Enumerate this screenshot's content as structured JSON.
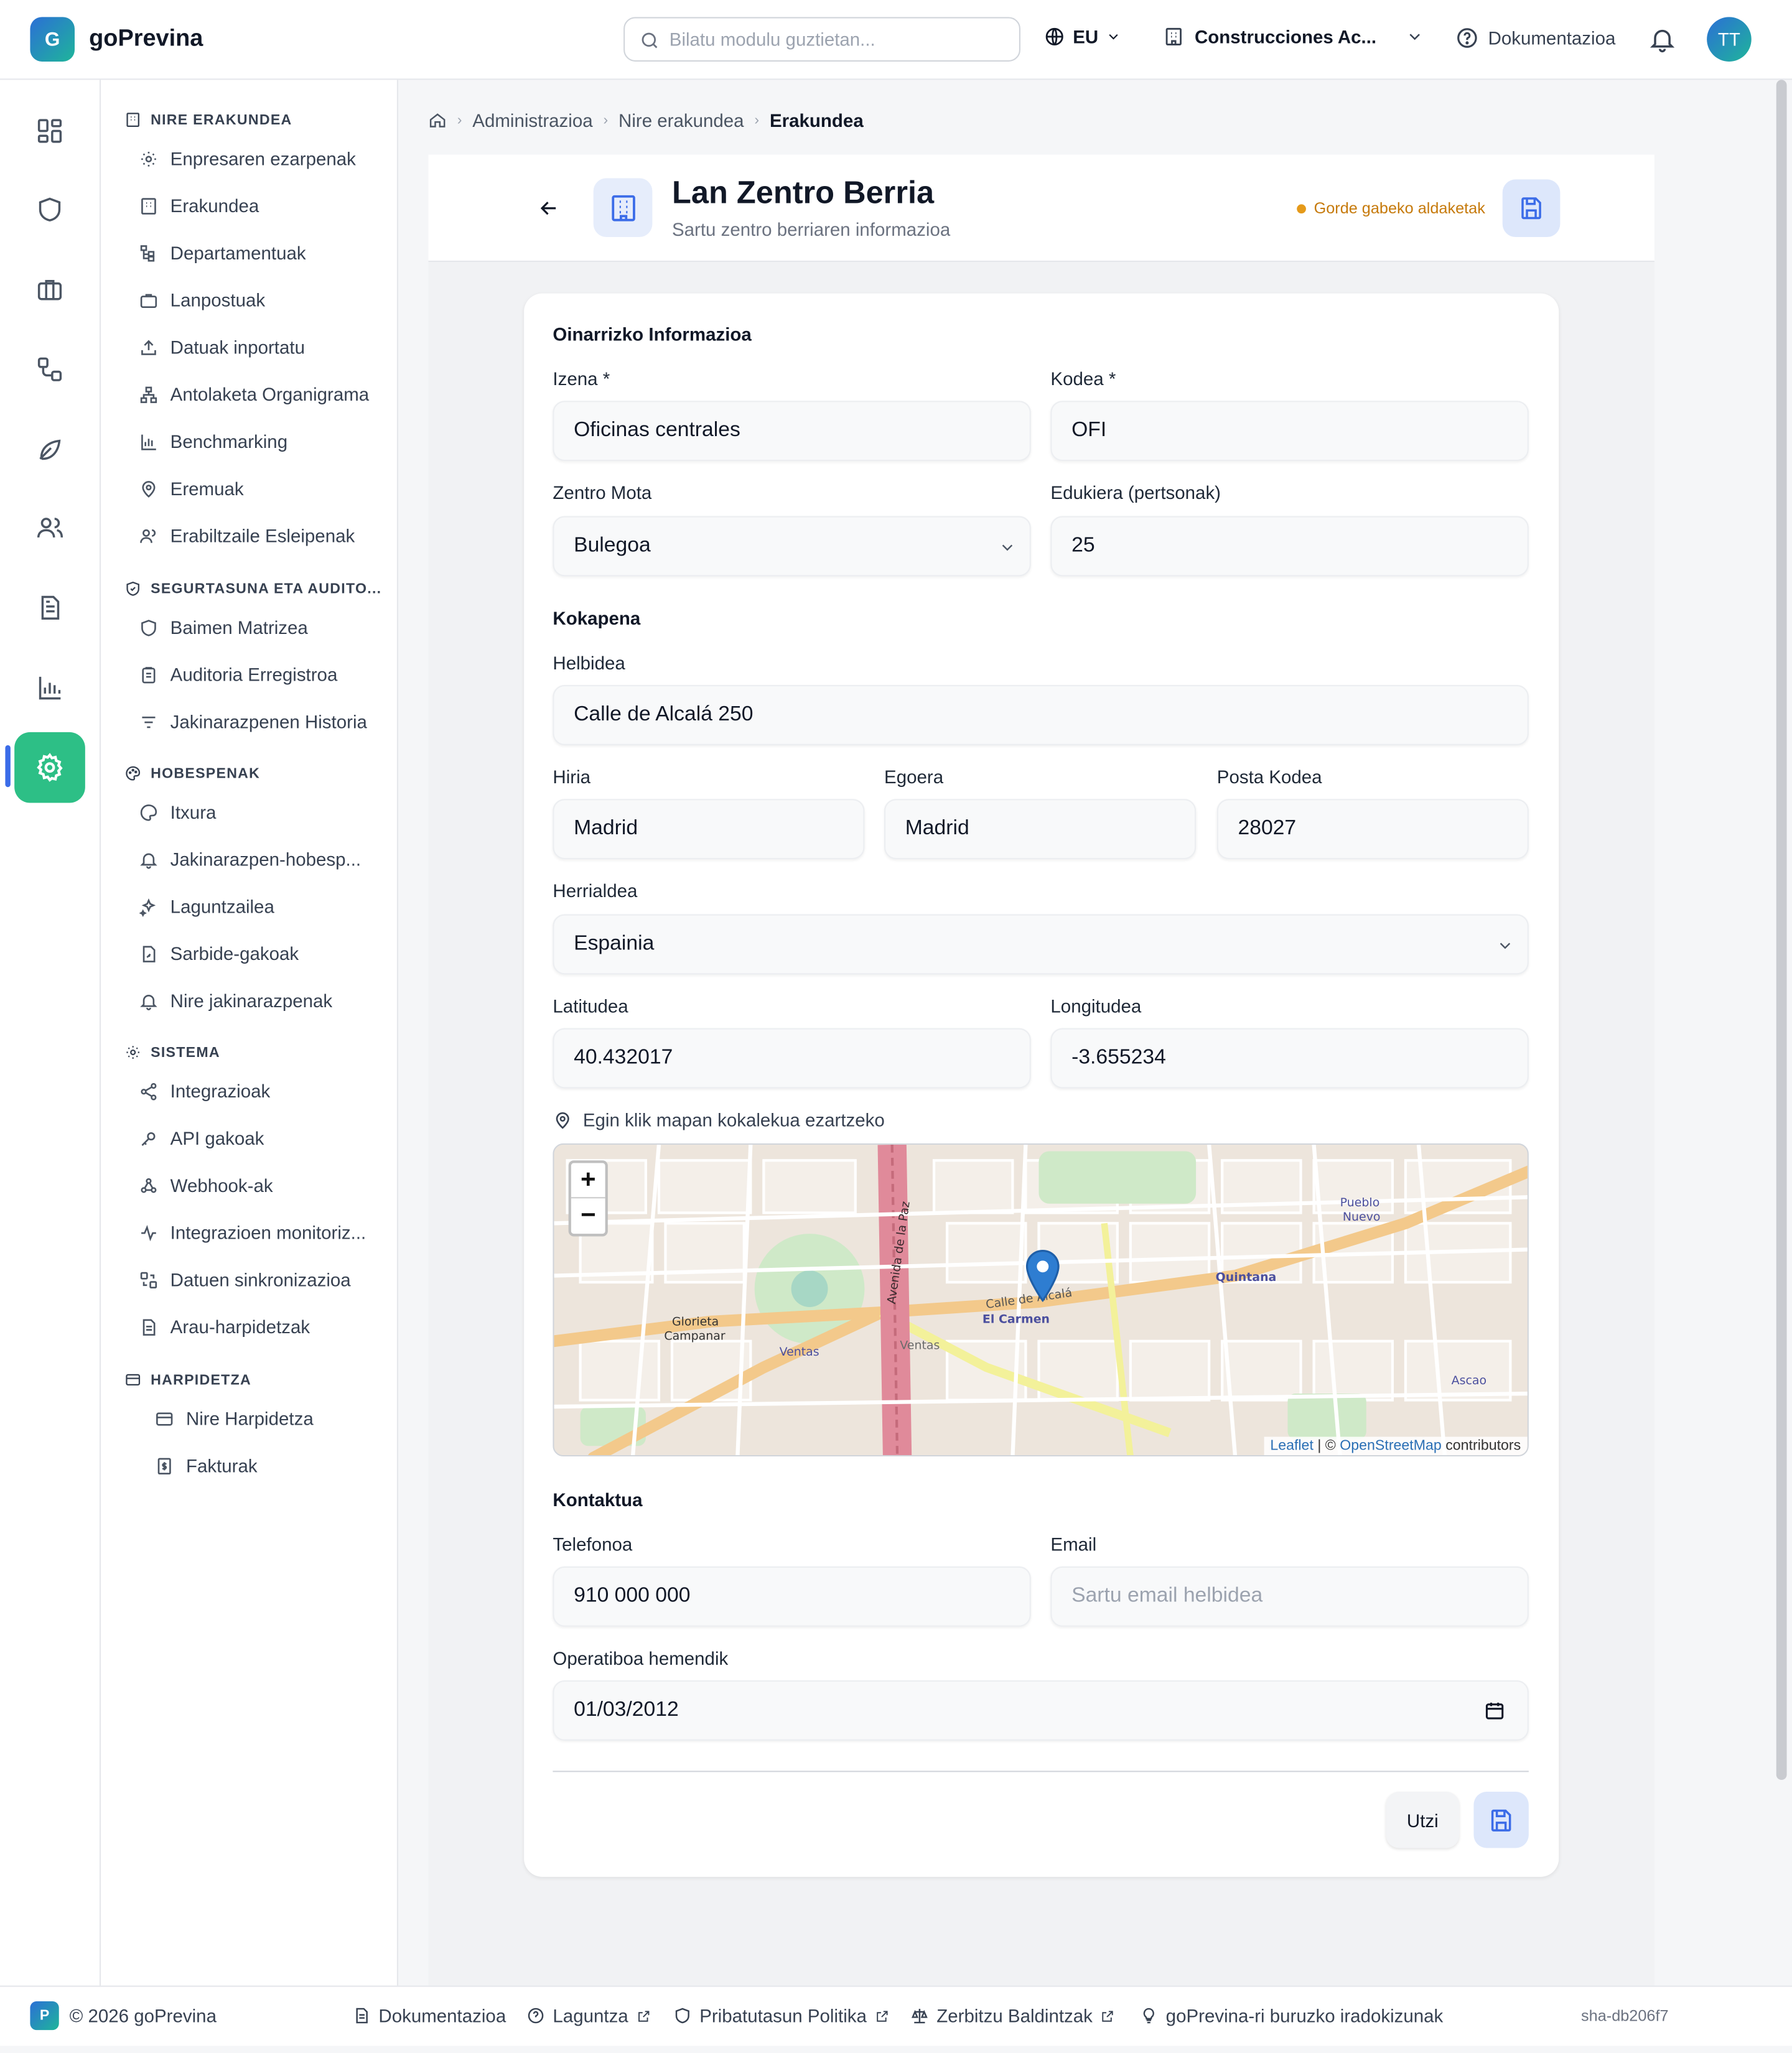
{
  "app": {
    "logo_letter": "G",
    "name": "goPrevina"
  },
  "topbar": {
    "search_placeholder": "Bilatu modulu guztietan...",
    "language": "EU",
    "organization": "Construcciones Ac...",
    "docs_label": "Dokumentazioa",
    "avatar_initials": "TT"
  },
  "rail": {
    "icons": [
      "dashboard-icon",
      "shield-icon",
      "briefcase-icon",
      "workflow-icon",
      "leaf-icon",
      "users-icon",
      "document-icon",
      "chart-icon",
      "gear-icon"
    ],
    "active": "gear-icon"
  },
  "sidebar": {
    "sections": [
      {
        "title": "NIRE ERAKUNDEA",
        "items": [
          "Enpresaren ezarpenak",
          "Erakundea",
          "Departamentuak",
          "Lanpostuak",
          "Datuak inportatu",
          "Antolaketa Organigrama",
          "Benchmarking",
          "Eremuak",
          "Erabiltzaile Esleipenak"
        ]
      },
      {
        "title": "SEGURTASUNA ETA AUDITO...",
        "items": [
          "Baimen Matrizea",
          "Auditoria Erregistroa",
          "Jakinarazpenen Historia"
        ]
      },
      {
        "title": "HOBESPENAK",
        "items": [
          "Itxura",
          "Jakinarazpen-hobesp...",
          "Laguntzailea",
          "Sarbide-gakoak",
          "Nire jakinarazpenak"
        ]
      },
      {
        "title": "SISTEMA",
        "items": [
          "Integrazioak",
          "API gakoak",
          "Webhook-ak",
          "Integrazioen monitoriz...",
          "Datuen sinkronizazioa",
          "Arau-harpidetzak"
        ]
      },
      {
        "title": "HARPIDETZA",
        "items": [
          "Nire Harpidetza",
          "Fakturak"
        ]
      }
    ]
  },
  "breadcrumb": {
    "items": [
      "Administrazioa",
      "Nire erakundea",
      "Erakundea"
    ]
  },
  "header": {
    "title": "Lan Zentro Berria",
    "subtitle": "Sartu zentro berriaren informazioa",
    "unsaved_label": "Gorde gabeko aldaketak"
  },
  "form": {
    "basic_section": "Oinarrizko Informazioa",
    "name_label": "Izena *",
    "name_value": "Oficinas centrales",
    "code_label": "Kodea *",
    "code_value": "OFI",
    "type_label": "Zentro Mota",
    "type_value": "Bulegoa",
    "capacity_label": "Edukiera (pertsonak)",
    "capacity_value": "25",
    "location_section": "Kokapena",
    "address_label": "Helbidea",
    "address_value": "Calle de Alcalá 250",
    "city_label": "Hiria",
    "city_value": "Madrid",
    "state_label": "Egoera",
    "state_value": "Madrid",
    "postal_label": "Posta Kodea",
    "postal_value": "28027",
    "country_label": "Herrialdea",
    "country_value": "Espainia",
    "lat_label": "Latitudea",
    "lat_value": "40.432017",
    "lng_label": "Longitudea",
    "lng_value": "-3.655234",
    "map_hint": "Egin klik mapan kokalekua ezartzeko",
    "contact_section": "Kontaktua",
    "phone_label": "Telefonoa",
    "phone_value": "910 000 000",
    "email_label": "Email",
    "email_placeholder": "Sartu email helbidea",
    "operative_label": "Operatiboa hemendik",
    "operative_value": "01/03/2012",
    "cancel_label": "Utzi"
  },
  "map": {
    "zoom_in": "+",
    "zoom_out": "−",
    "attribution_leaflet": "Leaflet",
    "attribution_sep": " | © ",
    "attribution_osm": "OpenStreetMap",
    "attribution_tail": " contributors",
    "labels": [
      "Avenida de la Paz",
      "El Carmen",
      "Ventas",
      "Quintana",
      "Pueblo Nuevo",
      "Ascao",
      "Glorieta Campanar",
      "Calle de Alcalá"
    ]
  },
  "footer": {
    "logo_letter": "P",
    "copyright": "© 2026 goPrevina",
    "links": [
      "Dokumentazioa",
      "Laguntza",
      "Pribatutasun Politika",
      "Zerbitzu Baldintzak",
      "goPrevina-ri buruzko iradokizunak"
    ],
    "version": "sha-db206f7"
  },
  "colors": {
    "accent": "#2dbf86",
    "primary": "#3b6ce8",
    "warning": "#e59a1a"
  }
}
